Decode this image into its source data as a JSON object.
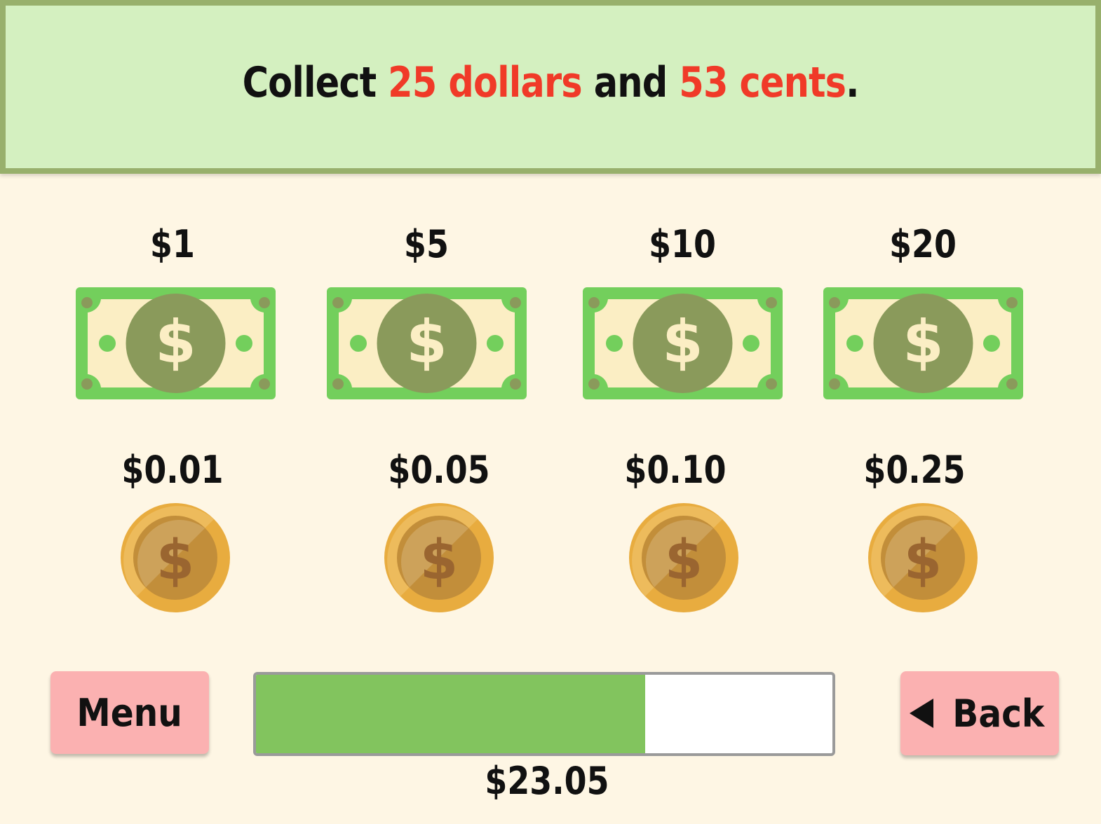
{
  "instruction": {
    "prefix": "Collect ",
    "dollars": "25 dollars",
    "middle": " and ",
    "cents": "53 cents",
    "suffix": "."
  },
  "bills": [
    {
      "label": "$1",
      "icon": "dollar-bill-icon"
    },
    {
      "label": "$5",
      "icon": "dollar-bill-icon"
    },
    {
      "label": "$10",
      "icon": "dollar-bill-icon"
    },
    {
      "label": "$20",
      "icon": "dollar-bill-icon"
    }
  ],
  "coins": [
    {
      "label": "$0.01",
      "icon": "coin-icon"
    },
    {
      "label": "$0.05",
      "icon": "coin-icon"
    },
    {
      "label": "$0.10",
      "icon": "coin-icon"
    },
    {
      "label": "$0.25",
      "icon": "coin-icon"
    }
  ],
  "buttons": {
    "menu_label": "Menu",
    "back_label": "Back"
  },
  "progress": {
    "fraction": 0.675,
    "total_label": "$23.05"
  },
  "colors": {
    "background": "#fef6e4",
    "banner": "#d4f0c0",
    "banner_border": "#98b06c",
    "highlight": "#f03a28",
    "bill_green": "#73cf5c",
    "bill_dark": "#8a9a5b",
    "coin_gold": "#e8ac3f",
    "button": "#fbb1b1",
    "progress_fill": "#82c45e"
  }
}
